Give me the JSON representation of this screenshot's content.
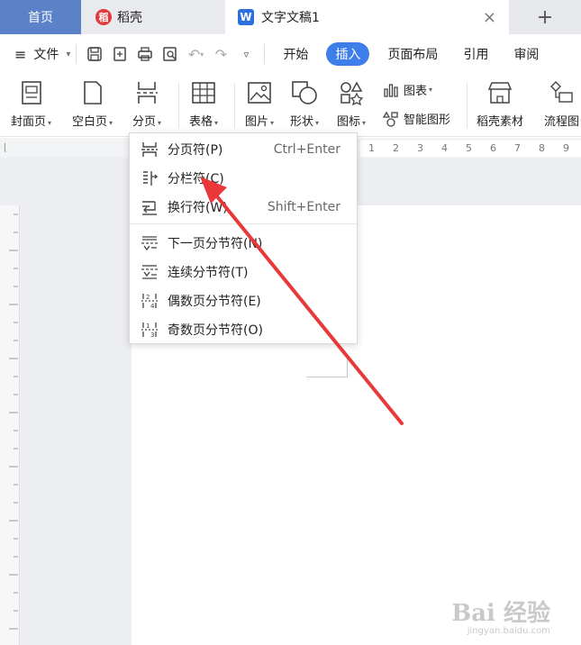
{
  "tabs": {
    "home": "首页",
    "daoke": "稻壳",
    "doc": "文字文稿1",
    "close": "×",
    "add": "+"
  },
  "menubar": {
    "file": "文件",
    "ribbon_tabs": [
      "开始",
      "插入",
      "页面布局",
      "引用",
      "审阅"
    ]
  },
  "toolbar": {
    "cover": "封面页",
    "blank": "空白页",
    "page_break": "分页",
    "table": "表格",
    "picture": "图片",
    "shape": "形状",
    "icon": "图标",
    "chart": "图表",
    "smart_shape": "智能图形",
    "daoke_material": "稻壳素材",
    "flowchart": "流程图"
  },
  "ruler": [
    "1",
    "2",
    "3",
    "4",
    "5",
    "6",
    "7",
    "8",
    "9",
    "1"
  ],
  "dropdown": {
    "items": [
      {
        "label": "分页符(P)",
        "shortcut": "Ctrl+Enter"
      },
      {
        "label": "分栏符(C)",
        "shortcut": ""
      },
      {
        "label": "换行符(W)",
        "shortcut": "Shift+Enter"
      },
      {
        "label": "下一页分节符(N)",
        "shortcut": ""
      },
      {
        "label": "连续分节符(T)",
        "shortcut": ""
      },
      {
        "label": "偶数页分节符(E)",
        "shortcut": ""
      },
      {
        "label": "奇数页分节符(O)",
        "shortcut": ""
      }
    ]
  },
  "watermark": {
    "main": "Bai 经验",
    "sub": "jingyan.baidu.com"
  },
  "colors": {
    "accent": "#3d7ee8",
    "home_tab": "#5b81c9",
    "arrow": "#e8383a"
  }
}
